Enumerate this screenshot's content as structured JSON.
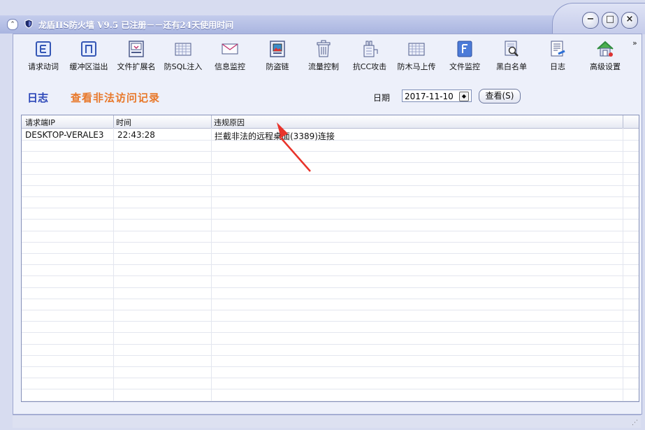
{
  "window": {
    "title": "龙盾IIS防火墙 V9.5 已注册－－还有24天使用时间"
  },
  "toolbar": {
    "items": [
      {
        "label": "请求动词",
        "icon": "letter-e-icon"
      },
      {
        "label": "缓冲区溢出",
        "icon": "letter-n-icon"
      },
      {
        "label": "文件扩展名",
        "icon": "monitor-icon"
      },
      {
        "label": "防SQL注入",
        "icon": "grid-icon"
      },
      {
        "label": "信息监控",
        "icon": "envelope-icon"
      },
      {
        "label": "防盗链",
        "icon": "image-frame-icon"
      },
      {
        "label": "流量控制",
        "icon": "trash-icon"
      },
      {
        "label": "抗CC攻击",
        "icon": "plug-icon"
      },
      {
        "label": "防木马上传",
        "icon": "grid-icon"
      },
      {
        "label": "文件监控",
        "icon": "letter-f-icon"
      },
      {
        "label": "黑白名单",
        "icon": "search-document-icon"
      },
      {
        "label": "日志",
        "icon": "document-pen-icon"
      },
      {
        "label": "高级设置",
        "icon": "house-icon"
      }
    ],
    "more": "»"
  },
  "log": {
    "title": "日志",
    "subtitle": "查看非法访问记录",
    "date_label": "日期",
    "date_value": "2017-11-10",
    "query_label": "查看(S)"
  },
  "table": {
    "columns": [
      "请求端IP",
      "时间",
      "违规原因"
    ],
    "rows": [
      [
        "DESKTOP-VERALE3",
        "22:43:28",
        "拦截非法的远程桌面(3389)连接"
      ]
    ]
  },
  "colors": {
    "accent": "#2b46b8",
    "subtitle": "#e8782a",
    "arrow": "#e8332a"
  }
}
